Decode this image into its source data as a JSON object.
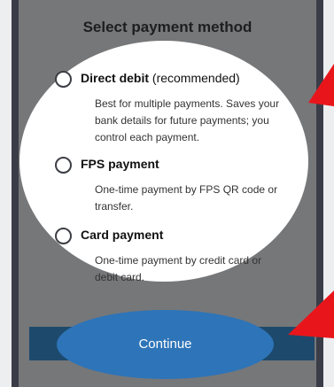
{
  "dialog": {
    "title": "Select payment method"
  },
  "payment_options": [
    {
      "name": "Direct debit",
      "suffix": "(recommended)",
      "description": [
        "Best for multiple payments. Saves your",
        "bank details for future payments; you",
        "control each payment."
      ],
      "selected": false
    },
    {
      "name": "FPS payment",
      "suffix": "",
      "description": [
        "One-time payment by FPS QR code or",
        "transfer."
      ],
      "selected": false
    },
    {
      "name": "Card payment",
      "suffix": "",
      "description": [
        "One-time payment by credit card or",
        "debit card."
      ],
      "selected": false
    }
  ],
  "actions": {
    "continue_label": "Continue"
  },
  "colors": {
    "overlay": "#767779",
    "highlight": "#ffffff",
    "button": "#1d4a6c",
    "button_highlight": "#2e74b8",
    "arrow": "#e8161b"
  },
  "annotations": [
    {
      "type": "arrow",
      "icon": "red-arrow-icon",
      "points_to": "payment_options"
    },
    {
      "type": "arrow",
      "icon": "red-arrow-icon",
      "points_to": "continue-button"
    }
  ]
}
